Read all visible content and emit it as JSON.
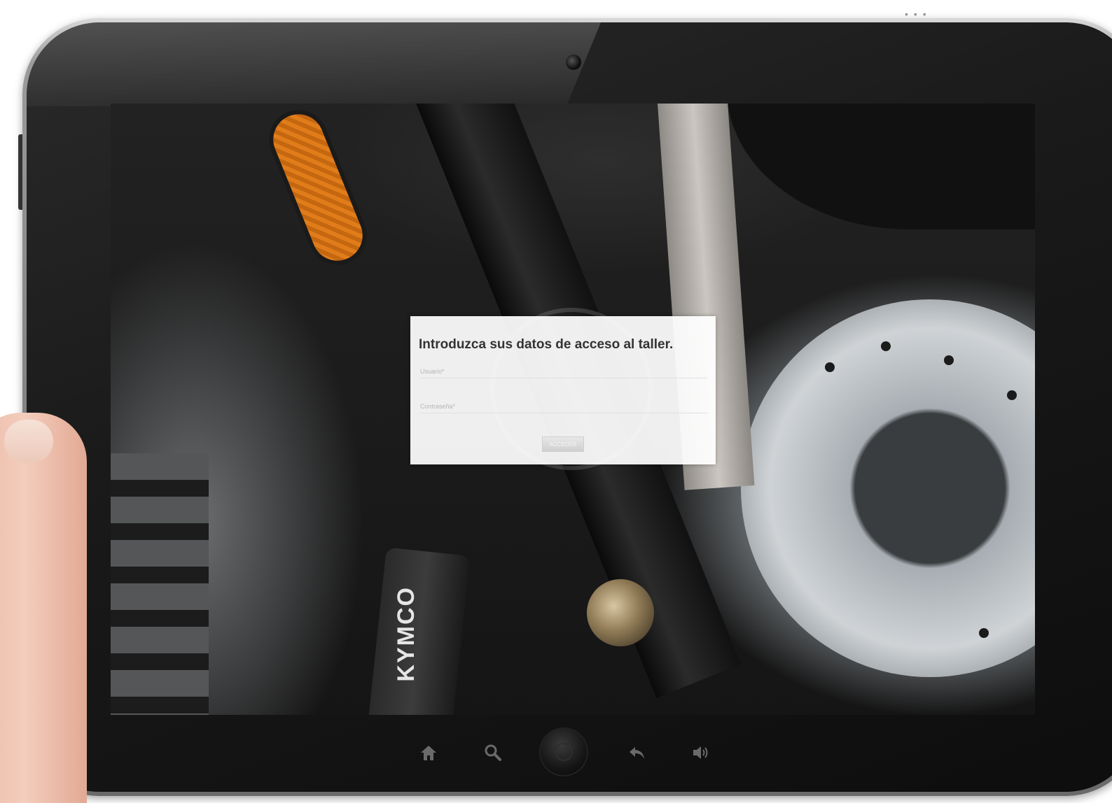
{
  "login": {
    "title": "Introduzca sus datos de acceso al taller.",
    "username_placeholder": "Usuario*",
    "password_placeholder": "Contraseña*",
    "submit_label": "ACCEDER"
  },
  "photo": {
    "caliper_brand": "KYMCO"
  },
  "navigation": {
    "icons": [
      "home-icon",
      "search-icon",
      "hardware-home-button",
      "back-icon",
      "volume-icon"
    ]
  },
  "colors": {
    "panel_background": "#ffffff",
    "title_text": "#333333",
    "button_background": "#d6d6d6",
    "reflector_orange": "#e07d1a"
  }
}
